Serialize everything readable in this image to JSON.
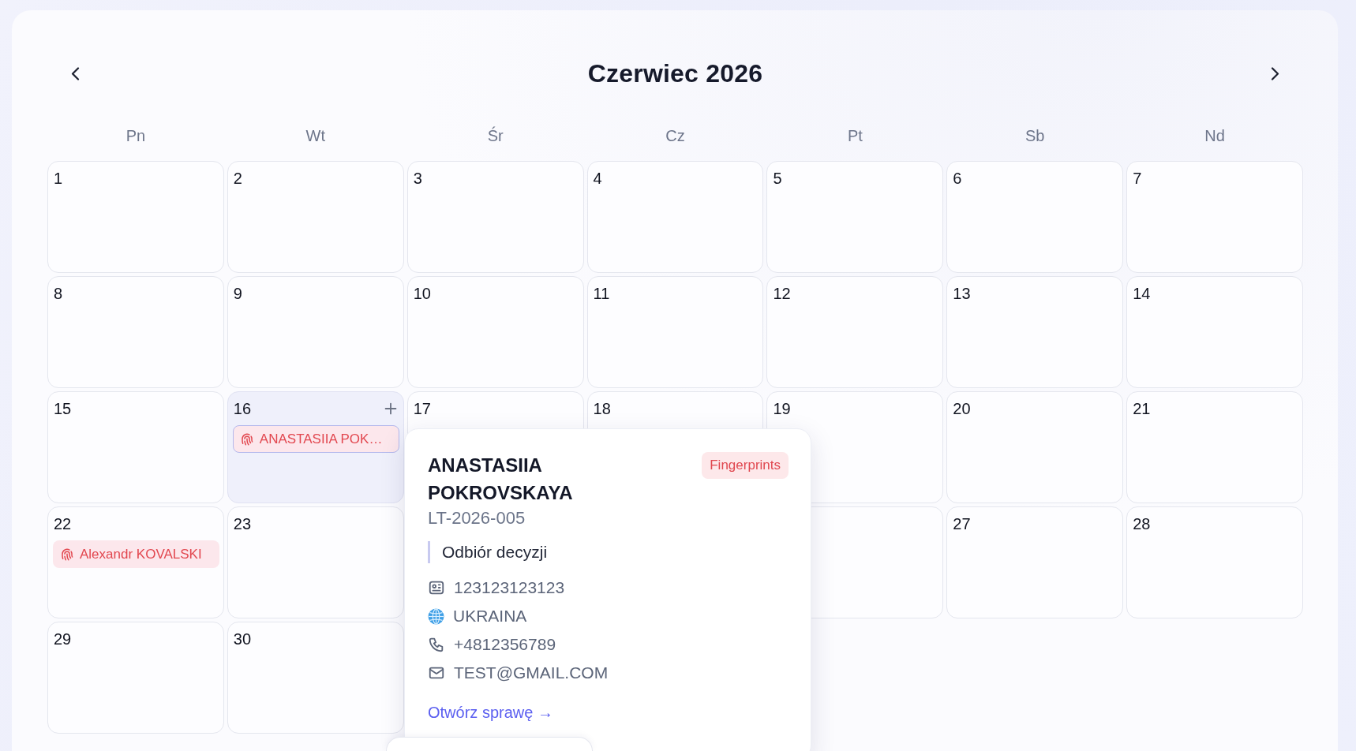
{
  "calendar": {
    "title": "Czerwiec 2026"
  },
  "weekdays": [
    "Pn",
    "Wt",
    "Śr",
    "Cz",
    "Pt",
    "Sb",
    "Nd"
  ],
  "weeks": [
    [
      {
        "kind": "day",
        "label": "1",
        "selected": false
      },
      {
        "kind": "day",
        "label": "2",
        "selected": false
      },
      {
        "kind": "day",
        "label": "3",
        "selected": false
      },
      {
        "kind": "day",
        "label": "4",
        "selected": false
      },
      {
        "kind": "day",
        "label": "5",
        "selected": false
      },
      {
        "kind": "day",
        "label": "6",
        "selected": false
      },
      {
        "kind": "day",
        "label": "7",
        "selected": false
      }
    ],
    [
      {
        "kind": "day",
        "label": "8",
        "selected": false
      },
      {
        "kind": "day",
        "label": "9",
        "selected": false
      },
      {
        "kind": "day",
        "label": "10",
        "selected": false
      },
      {
        "kind": "day",
        "label": "11",
        "selected": false
      },
      {
        "kind": "day",
        "label": "12",
        "selected": false
      },
      {
        "kind": "day",
        "label": "13",
        "selected": false
      },
      {
        "kind": "day",
        "label": "14",
        "selected": false
      }
    ],
    [
      {
        "kind": "day",
        "label": "15",
        "selected": false
      },
      {
        "kind": "day",
        "label": "16",
        "selected": true,
        "events": [
          {
            "label": "ANASTASIIA POK…",
            "selected": true
          }
        ]
      },
      {
        "kind": "day",
        "label": "17",
        "selected": false
      },
      {
        "kind": "day",
        "label": "18",
        "selected": false
      },
      {
        "kind": "day",
        "label": "19",
        "selected": false
      },
      {
        "kind": "day",
        "label": "20",
        "selected": false
      },
      {
        "kind": "day",
        "label": "21",
        "selected": false
      }
    ],
    [
      {
        "kind": "day",
        "label": "22",
        "selected": false,
        "events": [
          {
            "label": "Alexandr KOVALSKI",
            "selected": false
          }
        ]
      },
      {
        "kind": "day",
        "label": "23",
        "selected": false
      },
      {
        "kind": "hidden"
      },
      {
        "kind": "hidden"
      },
      {
        "kind": "blank",
        "selected": false
      },
      {
        "kind": "day",
        "label": "27",
        "selected": false
      },
      {
        "kind": "day",
        "label": "28",
        "selected": false
      }
    ],
    [
      {
        "kind": "day",
        "label": "29",
        "selected": false
      },
      {
        "kind": "day",
        "label": "30",
        "selected": false
      }
    ]
  ],
  "popover": {
    "name": "ANASTASIIA POKROVSKAYA",
    "tag": "Fingerprints",
    "case_number": "LT-2026-005",
    "purpose": "Odbiór decyzji",
    "details": [
      {
        "kind": "id",
        "text": "123123123123"
      },
      {
        "kind": "country",
        "text": "UKRAINA"
      },
      {
        "kind": "phone",
        "text": "+4812356789"
      },
      {
        "kind": "email",
        "text": "TEST@GMAIL.COM"
      }
    ],
    "link": "Otwórz sprawę →"
  }
}
